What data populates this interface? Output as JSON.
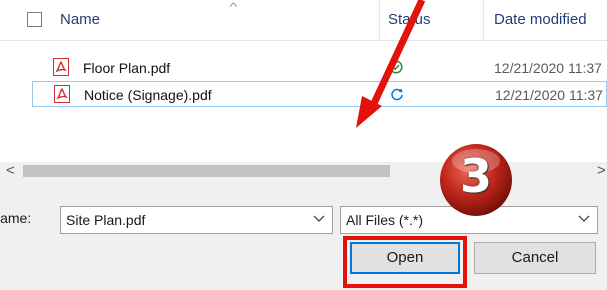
{
  "columns": {
    "name": "Name",
    "status": "Status",
    "date_modified": "Date modified"
  },
  "files": [
    {
      "name": "Floor Plan.pdf",
      "status_icon": "check-circle-icon",
      "date": "12/21/2020 11:37",
      "selected": false
    },
    {
      "name": "Notice (Signage).pdf",
      "status_icon": "sync-icon",
      "date": "12/21/2020 11:37",
      "selected": true
    }
  ],
  "file_name": {
    "label": "Name:",
    "value": "Site Plan.pdf"
  },
  "file_type": {
    "value": "All Files (*.*)"
  },
  "buttons": {
    "open": "Open",
    "cancel": "Cancel"
  },
  "annotation": {
    "step_number": "3"
  },
  "colors": {
    "header_text": "#1f3f73",
    "selection_border": "#99c8f1",
    "annotation_red": "#e3120b",
    "pdf_red": "#d32f2f",
    "status_green": "#2e8b3a",
    "sync_blue": "#0078d7"
  }
}
